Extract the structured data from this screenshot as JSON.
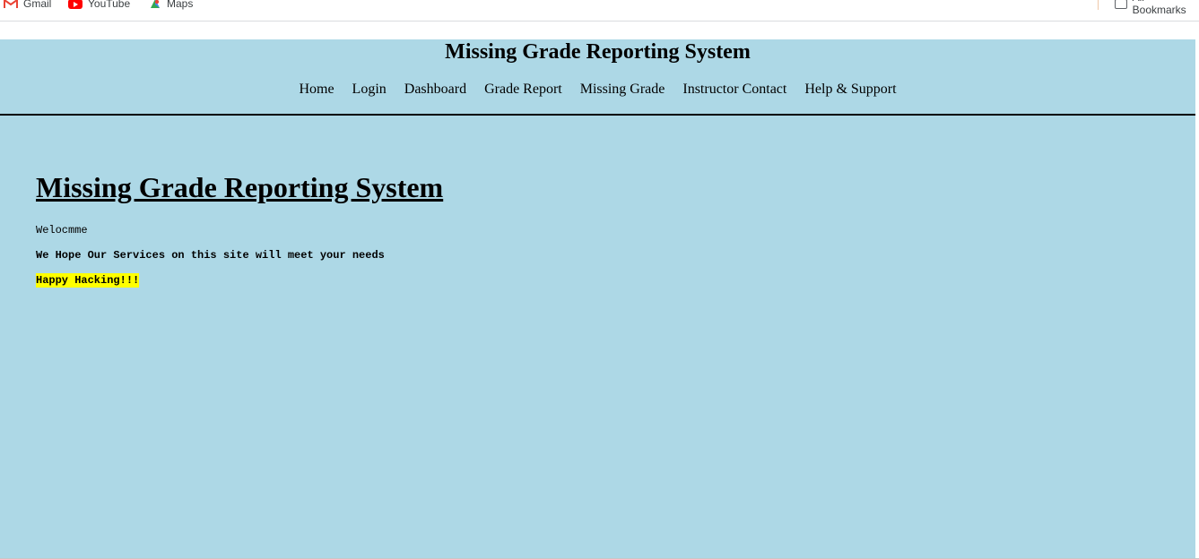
{
  "bookmarks": {
    "items": [
      {
        "label": "Gmail",
        "icon": "gmail-icon"
      },
      {
        "label": "YouTube",
        "icon": "youtube-icon"
      },
      {
        "label": "Maps",
        "icon": "maps-icon"
      }
    ],
    "all_bookmarks_label": "All Bookmarks"
  },
  "header": {
    "title": "Missing Grade Reporting System",
    "nav": [
      "Home",
      "Login",
      "Dashboard",
      "Grade Report",
      "Missing Grade",
      "Instructor Contact",
      "Help & Support"
    ]
  },
  "main": {
    "heading": "Missing Grade Reporting System",
    "welcome": "Welocmme",
    "hope": "We Hope Our Services on this site will meet your needs",
    "happy": "Happy Hacking!!!"
  },
  "colors": {
    "page_background": "#add8e6",
    "highlight": "#ffff00",
    "youtube_red": "#ff0000"
  }
}
